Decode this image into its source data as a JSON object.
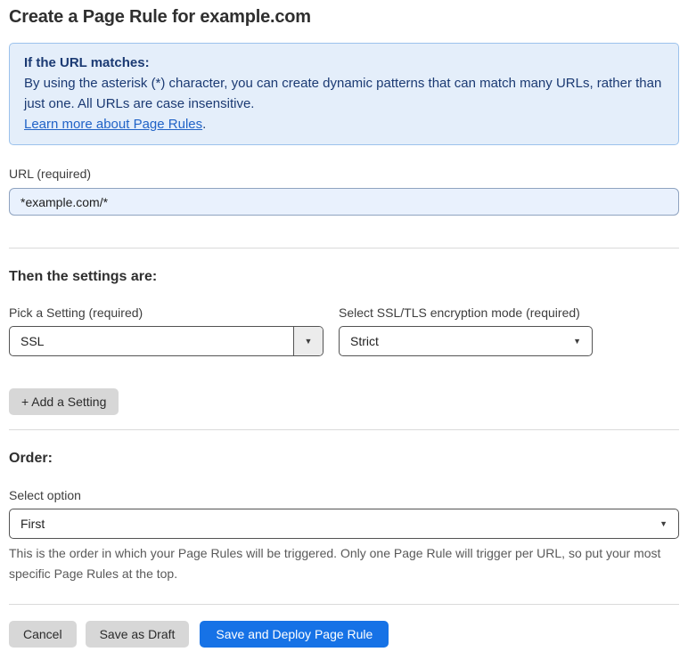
{
  "page": {
    "title": "Create a Page Rule for example.com"
  },
  "info_box": {
    "heading": "If the URL matches:",
    "body": "By using the asterisk (*) character, you can create dynamic patterns that can match many URLs, rather than just one. All URLs are case insensitive.",
    "link_text": "Learn more about Page Rules",
    "link_suffix": "."
  },
  "url_field": {
    "label": "URL (required)",
    "value": "*example.com/*"
  },
  "settings_section": {
    "heading": "Then the settings are:",
    "setting_picker": {
      "label": "Pick a Setting (required)",
      "value": "SSL"
    },
    "ssl_mode_picker": {
      "label": "Select SSL/TLS encryption mode (required)",
      "value": "Strict"
    },
    "add_setting_label": "+ Add a Setting"
  },
  "order_section": {
    "heading": "Order:",
    "select_label": "Select option",
    "select_value": "First",
    "help_text": "This is the order in which your Page Rules will be triggered. Only one Page Rule will trigger per URL, so put your most specific Page Rules at the top."
  },
  "footer": {
    "cancel_label": "Cancel",
    "save_draft_label": "Save as Draft",
    "save_deploy_label": "Save and Deploy Page Rule"
  },
  "icons": {
    "dropdown_arrow": "▼"
  },
  "colors": {
    "info_box_bg": "#e4eefa",
    "info_box_border": "#9cc2ec",
    "info_text": "#1b3a73",
    "link_blue": "#2163c7",
    "url_input_bg": "#e9f1fd",
    "primary_button_blue": "#1672e6",
    "gray_button": "#d7d7d7"
  }
}
